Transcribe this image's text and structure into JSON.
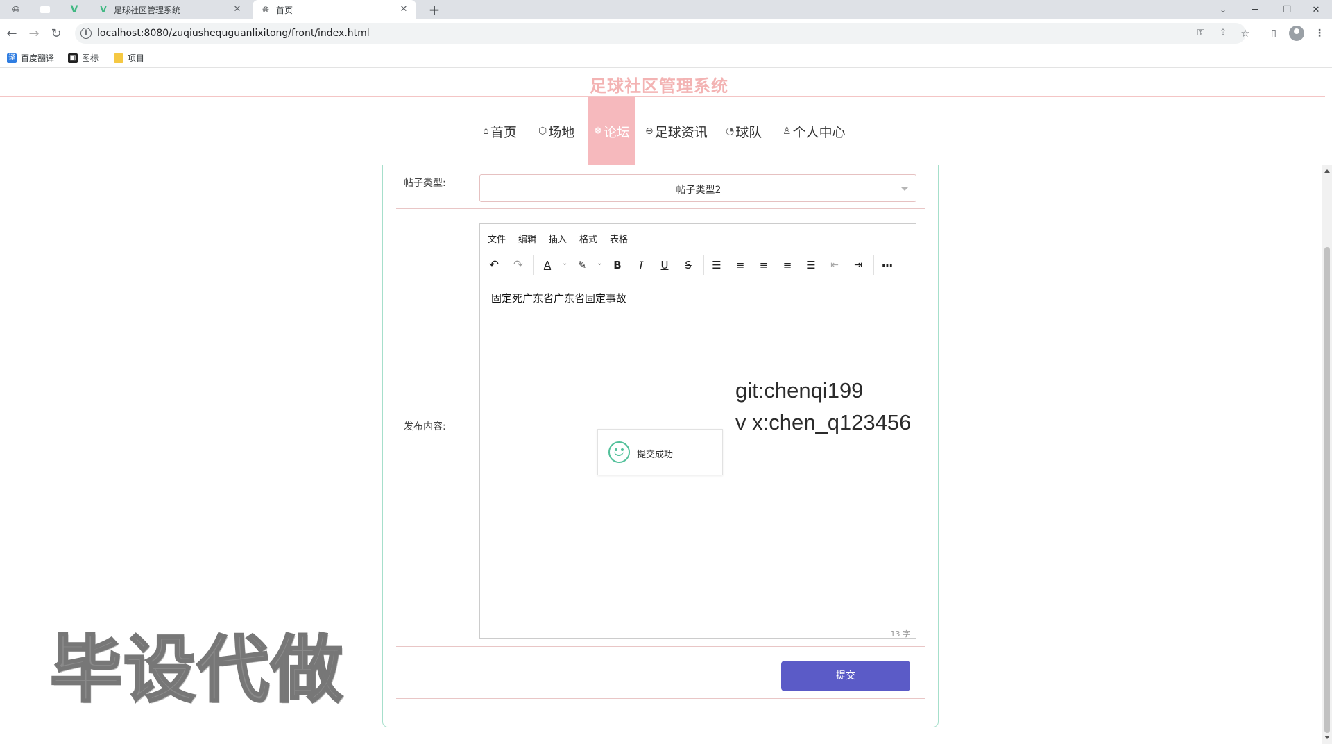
{
  "browser": {
    "tabs": [
      {
        "title": ""
      },
      {
        "title": ""
      },
      {
        "title": ""
      },
      {
        "title": "足球社区管理系统"
      },
      {
        "title": "首页"
      }
    ],
    "new_tab": "+",
    "window_controls": {
      "min": "─",
      "restore": "❐",
      "close": "✕"
    },
    "url": "localhost:8080/zuqiushequguanlixitong/front/index.html",
    "bookmarks": [
      {
        "label": "百度翻译"
      },
      {
        "label": "图标"
      },
      {
        "label": "项目"
      }
    ]
  },
  "site": {
    "title": "足球社区管理系统",
    "nav": [
      {
        "label": "首页",
        "icon": "home-icon"
      },
      {
        "label": "场地",
        "icon": "cube-icon"
      },
      {
        "label": "论坛",
        "icon": "snowflake-icon",
        "active": true
      },
      {
        "label": "足球资讯",
        "icon": "news-icon"
      },
      {
        "label": "球队",
        "icon": "team-icon"
      },
      {
        "label": "个人中心",
        "icon": "user-icon"
      }
    ],
    "active_color": "#f6b9bd"
  },
  "form": {
    "post_type_label": "帖子类型:",
    "post_type_value": "帖子类型2",
    "content_label": "发布内容:",
    "editor_menu": [
      "文件",
      "编辑",
      "插入",
      "格式",
      "表格"
    ],
    "editor_content": "固定死广东省广东省固定事故",
    "word_count": "13 字",
    "submit_label": "提交",
    "submit_color": "#5b5bc7"
  },
  "toast": {
    "message": "提交成功"
  },
  "overlay": {
    "line1": "git:chenqi199",
    "line2": "v x:chen_q123456",
    "watermark": "毕设代做"
  }
}
